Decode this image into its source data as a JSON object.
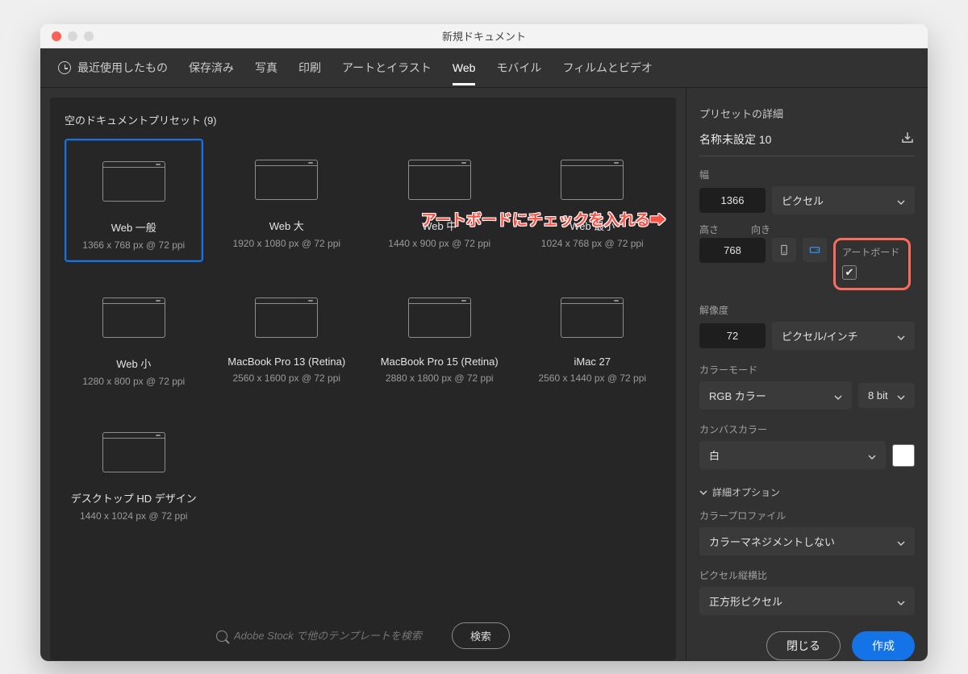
{
  "window": {
    "title": "新規ドキュメント"
  },
  "tabs": {
    "recent": "最近使用したもの",
    "saved": "保存済み",
    "photo": "写真",
    "print": "印刷",
    "art": "アートとイラスト",
    "web": "Web",
    "mobile": "モバイル",
    "film": "フィルムとビデオ"
  },
  "presets_header": "空のドキュメントプリセット  (9)",
  "presets": [
    {
      "name": "Web 一般",
      "sub": "1366 x 768 px @ 72 ppi"
    },
    {
      "name": "Web 大",
      "sub": "1920 x 1080 px @ 72 ppi"
    },
    {
      "name": "Web 中",
      "sub": "1440 x 900 px @ 72 ppi"
    },
    {
      "name": "Web 最小",
      "sub": "1024 x 768 px @ 72 ppi"
    },
    {
      "name": "Web 小",
      "sub": "1280 x 800 px @ 72 ppi"
    },
    {
      "name": "MacBook Pro 13 (Retina)",
      "sub": "2560 x 1600 px @ 72 ppi"
    },
    {
      "name": "MacBook Pro 15 (Retina)",
      "sub": "2880 x 1800 px @ 72 ppi"
    },
    {
      "name": "iMac 27",
      "sub": "2560 x 1440 px @ 72 ppi"
    },
    {
      "name": "デスクトップ HD デザイン",
      "sub": "1440 x 1024 px @ 72 ppi"
    }
  ],
  "search": {
    "placeholder": "Adobe Stock で他のテンプレートを検索",
    "button": "検索"
  },
  "details": {
    "heading": "プリセットの詳細",
    "doc_name": "名称未設定 10",
    "width_label": "幅",
    "width_value": "1366",
    "units": "ピクセル",
    "height_label": "高さ",
    "orientation_label": "向き",
    "artboard_label": "アートボード",
    "height_value": "768",
    "resolution_label": "解像度",
    "resolution_value": "72",
    "resolution_units": "ピクセル/インチ",
    "colormode_label": "カラーモード",
    "colormode_value": "RGB カラー",
    "bitdepth": "8 bit",
    "canvas_label": "カンバスカラー",
    "canvas_value": "白",
    "advanced": "詳細オプション",
    "profile_label": "カラープロファイル",
    "profile_value": "カラーマネジメントしない",
    "pixel_aspect_label": "ピクセル縦横比",
    "pixel_aspect_value": "正方形ピクセル",
    "close": "閉じる",
    "create": "作成"
  },
  "annotation": "アートボードにチェックを入れる➡"
}
